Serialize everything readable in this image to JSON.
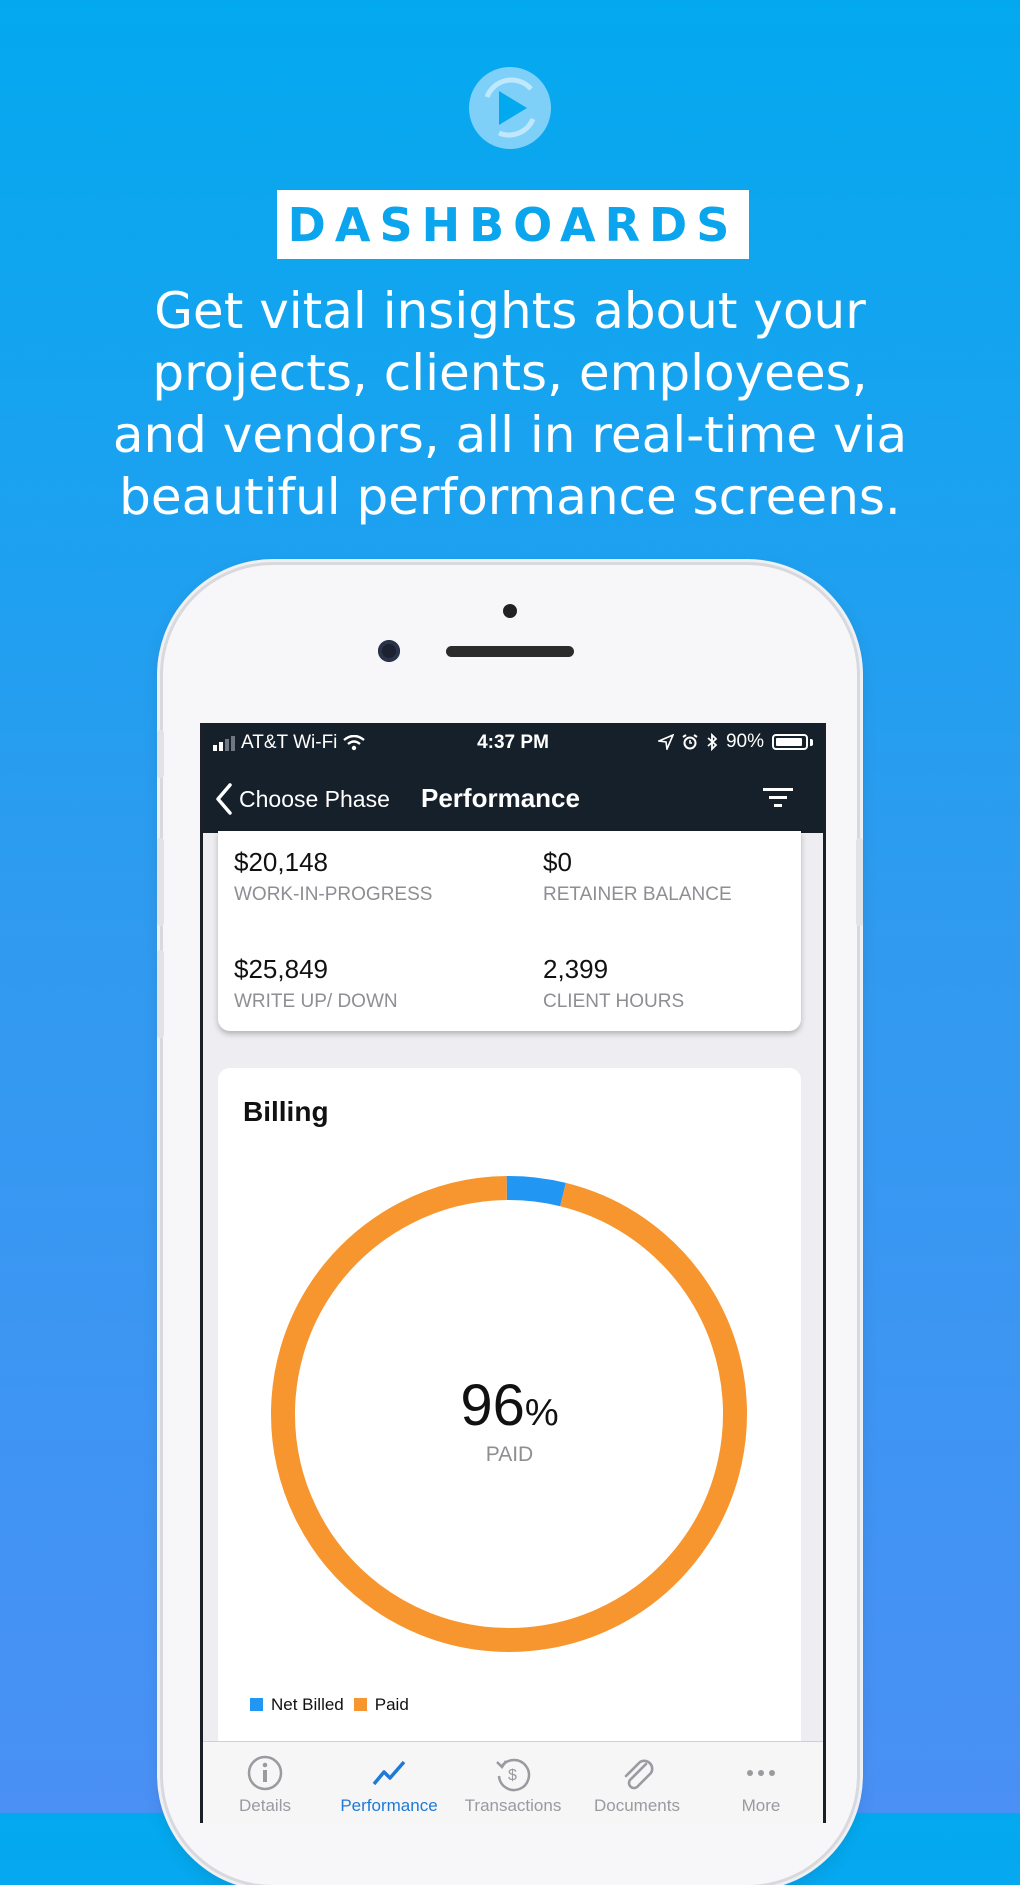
{
  "promo": {
    "logo_icon": "play-circle-logo-icon",
    "title": "DASHBOARDS",
    "headline_lines": [
      "Get vital insights about your",
      "projects, clients, employees,",
      "and vendors, all in real-time via",
      "beautiful performance screens."
    ]
  },
  "status_bar": {
    "carrier": "AT&T Wi-Fi",
    "time": "4:37 PM",
    "battery": "90%"
  },
  "nav": {
    "back_label": "Choose Phase",
    "title": "Performance",
    "filter_icon": "filter-icon"
  },
  "metrics": [
    {
      "value": "$20,148",
      "label": "WORK-IN-PROGRESS"
    },
    {
      "value": "$0",
      "label": "RETAINER BALANCE"
    },
    {
      "value": "$25,849",
      "label": "WRITE UP/ DOWN"
    },
    {
      "value": "2,399",
      "label": "CLIENT HOURS"
    }
  ],
  "billing": {
    "title": "Billing",
    "percent_value": "96",
    "percent_sign": "%",
    "center_label": "PAID"
  },
  "chart_data": {
    "type": "pie",
    "donut": true,
    "title": "Billing",
    "slices": [
      {
        "name": "Net Billed",
        "value": 4,
        "color": "#2196f3"
      },
      {
        "name": "Paid",
        "value": 96,
        "color": "#f7962e"
      }
    ],
    "center_text": "96%",
    "center_subtext": "PAID",
    "legend_position": "bottom-left"
  },
  "tabs": [
    {
      "label": "Details",
      "icon": "info-icon",
      "active": false
    },
    {
      "label": "Performance",
      "icon": "trend-line-icon",
      "active": true
    },
    {
      "label": "Transactions",
      "icon": "history-dollar-icon",
      "active": false
    },
    {
      "label": "Documents",
      "icon": "paperclip-icon",
      "active": false
    },
    {
      "label": "More",
      "icon": "more-dots-icon",
      "active": false
    }
  ],
  "colors": {
    "accent": "#0aa5ec",
    "nav_bg": "#16202a",
    "paid": "#f7962e",
    "net_billed": "#2196f3",
    "tab_active": "#1f7ad6"
  }
}
